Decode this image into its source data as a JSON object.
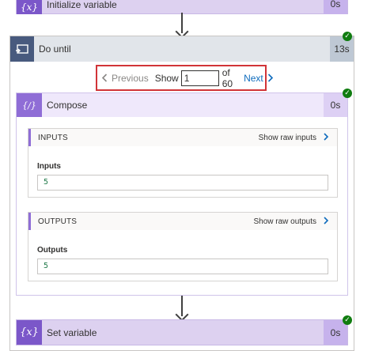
{
  "init_variable": {
    "icon_text": "{x}",
    "title": "Initialize variable",
    "duration": "0s"
  },
  "do_until": {
    "title": "Do until",
    "duration": "13s"
  },
  "pager": {
    "previous_label": "Previous",
    "show_label": "Show",
    "page_value": "1",
    "of_label": "of 60",
    "next_label": "Next"
  },
  "compose": {
    "icon_text": "{/}",
    "title": "Compose",
    "duration": "0s",
    "inputs": {
      "section_title": "INPUTS",
      "raw_link": "Show raw inputs",
      "field_label": "Inputs",
      "field_value": "5"
    },
    "outputs": {
      "section_title": "OUTPUTS",
      "raw_link": "Show raw outputs",
      "field_label": "Outputs",
      "field_value": "5"
    }
  },
  "set_variable": {
    "icon_text": "{x}",
    "title": "Set variable",
    "duration": "0s"
  },
  "colors": {
    "variable_action": "#7b57c9",
    "compose_action": "#8f6dd6",
    "loop_action": "#485a7e",
    "success": "#107c10",
    "highlight_border": "#d13438",
    "link": "#0f6cbd"
  }
}
